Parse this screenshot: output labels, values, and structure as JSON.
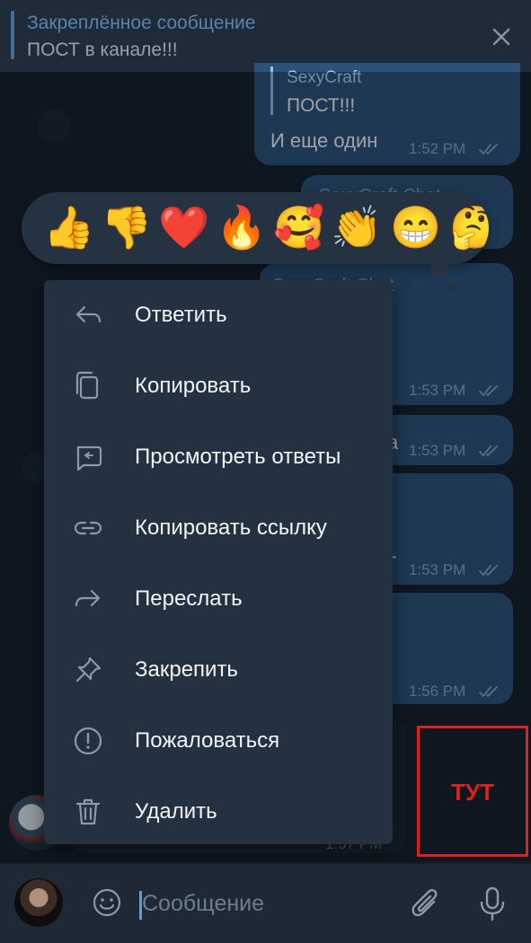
{
  "pinned": {
    "title": "Закреплённое сообщение",
    "text": "ПОСТ в канале!!!"
  },
  "messages": [
    {
      "forward_name": "SexyCraft",
      "forward_text": "ПОСТ!!!",
      "text": "И еще один",
      "time": "1:52 PM"
    },
    {
      "name": "SexyCraft Chat"
    },
    {
      "name": "SexyCraft Chat",
      "tail": "!",
      "time": "1:53 PM"
    },
    {
      "tail": "a",
      "time": "1:53 PM"
    },
    {
      "tail": "Г",
      "time": "1:53 PM"
    },
    {
      "tail": "!",
      "time": "1:56 PM"
    },
    {
      "time": "1:57 PM"
    }
  ],
  "reactions": [
    {
      "emoji": "👍",
      "name": "thumbs-up"
    },
    {
      "emoji": "👎",
      "name": "thumbs-down"
    },
    {
      "emoji": "❤️",
      "name": "heart"
    },
    {
      "emoji": "🔥",
      "name": "fire"
    },
    {
      "emoji": "🥰",
      "name": "smiling-face-with-hearts"
    },
    {
      "emoji": "👏",
      "name": "clapping-hands"
    },
    {
      "emoji": "😁",
      "name": "beaming-face"
    },
    {
      "emoji": "🤔",
      "name": "thinking-face"
    }
  ],
  "menu": {
    "items": [
      {
        "label": "Ответить",
        "icon": "reply-icon"
      },
      {
        "label": "Копировать",
        "icon": "copy-icon"
      },
      {
        "label": "Просмотреть ответы",
        "icon": "view-replies-icon"
      },
      {
        "label": "Копировать ссылку",
        "icon": "link-icon"
      },
      {
        "label": "Переслать",
        "icon": "forward-icon"
      },
      {
        "label": "Закрепить",
        "icon": "pin-icon"
      },
      {
        "label": "Пожаловаться",
        "icon": "report-icon"
      },
      {
        "label": "Удалить",
        "icon": "delete-icon"
      }
    ]
  },
  "annotation": {
    "text": "ТУТ",
    "color": "#e02020"
  },
  "input": {
    "placeholder": "Сообщение"
  },
  "colors": {
    "accent": "#63a2e0",
    "outgoing_bubble": "#2b5278",
    "menu_bg": "#243140"
  }
}
